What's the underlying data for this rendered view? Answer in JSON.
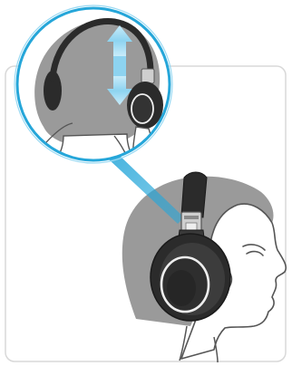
{
  "figure": {
    "panel": "instruction-panel",
    "inset": "detail-magnifier",
    "subjects": [
      "head-profile",
      "headphones",
      "headband-adjuster",
      "adjust-arrows-icon"
    ]
  },
  "colors": {
    "outline": "#555555",
    "hair": "#9a9a9a",
    "skin": "#ffffff",
    "headphone_dark": "#2b2b2b",
    "headphone_mid": "#444444",
    "slider_light": "#cfcfcf",
    "ring": "#eeeeee",
    "callout_blue": "#25a6d9",
    "callout_blue_light": "#9bdaf3",
    "arrow_blue": "#8dd3f0"
  }
}
